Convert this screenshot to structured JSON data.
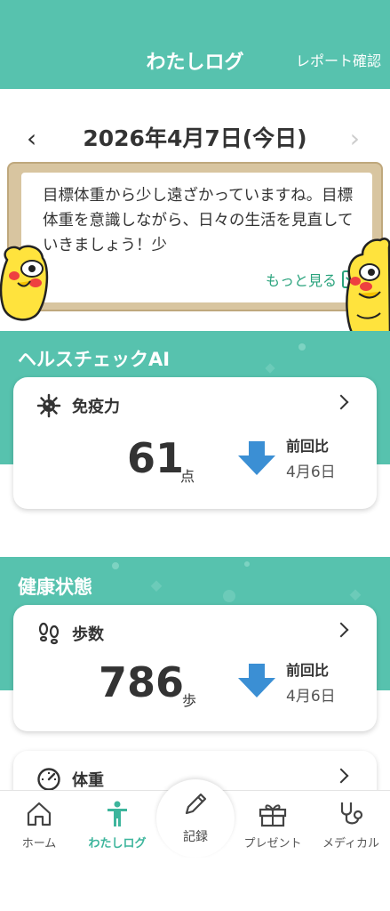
{
  "header": {
    "title": "わたしログ",
    "report_link": "レポート確認"
  },
  "date_nav": {
    "date": "2026年4月7日(今日)",
    "prev_icon": "chevron-left-icon",
    "next_icon": "chevron-right-icon"
  },
  "message_board": {
    "text": "目標体重から少し遠ざかっていますね。目標体重を意識しながら、日々の生活を見直していきましょう！少",
    "more_label": "もっと見る"
  },
  "health_check": {
    "section_title": "ヘルスチェックAI",
    "card": {
      "title": "免疫力",
      "icon": "virus-icon",
      "value": "61",
      "unit": "点",
      "trend": "down",
      "compare_label": "前回比",
      "compare_date": "4月6日"
    }
  },
  "health_status": {
    "section_title": "健康状態",
    "cards": [
      {
        "title": "歩数",
        "icon": "footprints-icon",
        "value": "786",
        "unit": "歩",
        "trend": "down",
        "compare_label": "前回比",
        "compare_date": "4月6日"
      },
      {
        "title": "体重",
        "icon": "gauge-icon"
      }
    ]
  },
  "bottom_nav": {
    "items": [
      {
        "label": "ホーム",
        "icon": "home-icon"
      },
      {
        "label": "わたしログ",
        "icon": "person-icon",
        "active": true
      },
      {
        "label": "記録",
        "icon": "pencil-icon"
      },
      {
        "label": "プレゼント",
        "icon": "gift-icon"
      },
      {
        "label": "メディカル",
        "icon": "stethoscope-icon"
      }
    ]
  },
  "colors": {
    "brand": "#57c2ae",
    "active": "#3db59c",
    "arrow": "#3b8fd4",
    "link": "#2aa37d"
  }
}
